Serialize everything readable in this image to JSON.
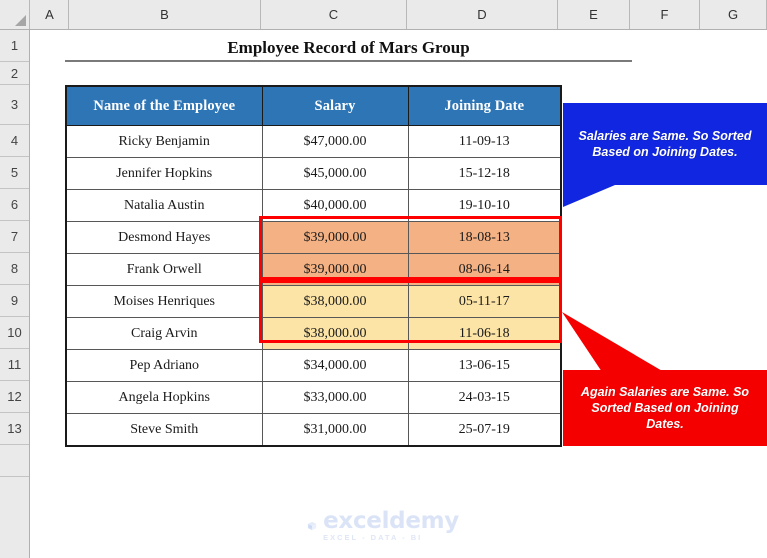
{
  "spreadsheet": {
    "column_headers": [
      "A",
      "B",
      "C",
      "D",
      "E",
      "F",
      "G"
    ],
    "row_headers": [
      "1",
      "2",
      "3",
      "4",
      "5",
      "6",
      "7",
      "8",
      "9",
      "10",
      "11",
      "12",
      "13"
    ],
    "select_all_icon": "select-all-corner-icon"
  },
  "title": "Employee Record of Mars Group",
  "table": {
    "headers": [
      "Name of the Employee",
      "Salary",
      "Joining Date"
    ],
    "header_fill": "#2E75B6",
    "header_text_color": "#FFFFFF",
    "rows": [
      {
        "name": "Ricky Benjamin",
        "salary": "$47,000.00",
        "date": "11-09-13",
        "fill": "none"
      },
      {
        "name": "Jennifer Hopkins",
        "salary": "$45,000.00",
        "date": "15-12-18",
        "fill": "none"
      },
      {
        "name": "Natalia Austin",
        "salary": "$40,000.00",
        "date": "19-10-10",
        "fill": "none"
      },
      {
        "name": "Desmond Hayes",
        "salary": "$39,000.00",
        "date": "18-08-13",
        "fill": "orange"
      },
      {
        "name": "Frank Orwell",
        "salary": "$39,000.00",
        "date": "08-06-14",
        "fill": "orange"
      },
      {
        "name": "Moises Henriques",
        "salary": "$38,000.00",
        "date": "05-11-17",
        "fill": "yellow"
      },
      {
        "name": "Craig Arvin",
        "salary": "$38,000.00",
        "date": "11-06-18",
        "fill": "yellow"
      },
      {
        "name": "Pep Adriano",
        "salary": "$34,000.00",
        "date": "13-06-15",
        "fill": "none"
      },
      {
        "name": "Angela Hopkins",
        "salary": "$33,000.00",
        "date": "24-03-15",
        "fill": "none"
      },
      {
        "name": "Steve Smith",
        "salary": "$31,000.00",
        "date": "25-07-19",
        "fill": "none"
      }
    ],
    "fill_colors": {
      "orange": "#F4B183",
      "yellow": "#FCE4A6"
    }
  },
  "annotations": {
    "highlight_boxes": [
      {
        "name": "orange-group-outline",
        "color": "#FF0000"
      },
      {
        "name": "yellow-group-outline",
        "color": "#FF0000"
      }
    ],
    "blue_callout": {
      "text": "Salaries are Same. So Sorted Based on Joining Dates.",
      "color": "#1026E0"
    },
    "red_callout": {
      "text": "Again Salaries are Same. So Sorted Based on Joining Dates.",
      "color": "#F40000"
    }
  },
  "watermark": {
    "name": "exceldemy",
    "tagline": "EXCEL - DATA - BI",
    "color": "#DBE4F7"
  }
}
